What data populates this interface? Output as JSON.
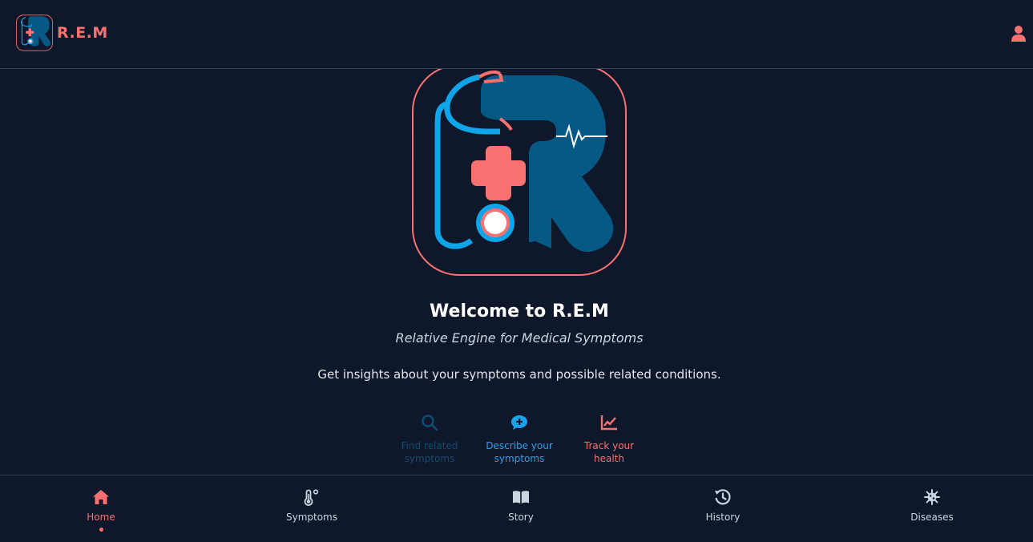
{
  "brand": {
    "name": "R.E.M",
    "logo_icon": "rem-logo-icon"
  },
  "header": {
    "user_icon": "user-icon"
  },
  "hero": {
    "title": "Welcome to R.E.M",
    "subtitle": "Relative Engine for Medical Symptoms",
    "description": "Get insights about your symptoms and possible related conditions."
  },
  "features": [
    {
      "label_line1": "Find related",
      "label_line2": "symptoms",
      "icon": "search-icon",
      "color": "#0e4d72"
    },
    {
      "label_line1": "Describe your",
      "label_line2": "symptoms",
      "icon": "chat-plus-icon",
      "color": "#1ba3ee"
    },
    {
      "label_line1": "Track your",
      "label_line2": "health",
      "icon": "chart-line-icon",
      "color": "#f87171"
    }
  ],
  "nav": [
    {
      "label": "Home",
      "icon": "home-icon",
      "active": true
    },
    {
      "label": "Symptoms",
      "icon": "thermometer-icon",
      "active": false
    },
    {
      "label": "Story",
      "icon": "book-icon",
      "active": false
    },
    {
      "label": "History",
      "icon": "history-icon",
      "active": false
    },
    {
      "label": "Diseases",
      "icon": "virus-icon",
      "active": false
    }
  ],
  "colors": {
    "background": "#0f172a",
    "accent": "#f87171",
    "brand_blue": "#1ba3ee",
    "dark_blue": "#0e4d72",
    "divider": "#334155"
  }
}
